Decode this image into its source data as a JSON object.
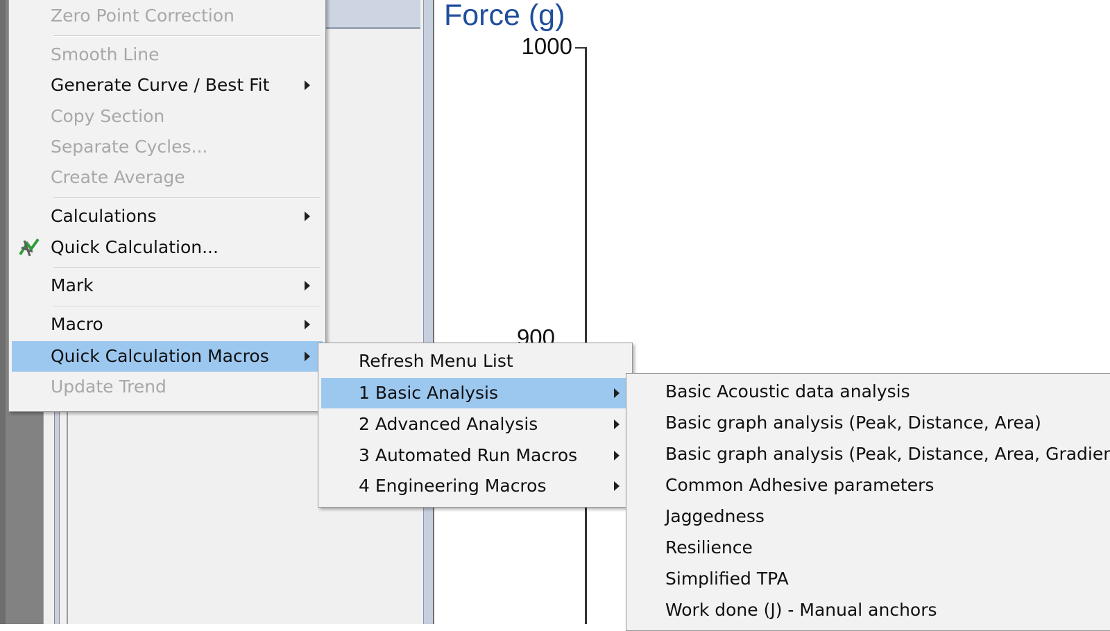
{
  "chart": {
    "title": "Force (g)",
    "y_ticks": [
      "1000",
      "900"
    ]
  },
  "context_menu": {
    "items": [
      {
        "label": "Zero Point Correction",
        "enabled": false,
        "submenu": false
      },
      {
        "label": "Smooth Line",
        "enabled": false,
        "submenu": false
      },
      {
        "label": "Generate Curve / Best Fit",
        "enabled": true,
        "submenu": true
      },
      {
        "label": "Copy Section",
        "enabled": false,
        "submenu": false
      },
      {
        "label": "Separate Cycles...",
        "enabled": false,
        "submenu": false
      },
      {
        "label": "Create Average",
        "enabled": false,
        "submenu": false
      },
      {
        "label": "Calculations",
        "enabled": true,
        "submenu": true
      },
      {
        "label": "Quick Calculation...",
        "enabled": true,
        "submenu": false,
        "icon": "quick-calculation-icon"
      },
      {
        "label": "Mark",
        "enabled": true,
        "submenu": true
      },
      {
        "label": "Macro",
        "enabled": true,
        "submenu": true
      },
      {
        "label": "Quick Calculation Macros",
        "enabled": true,
        "submenu": true,
        "highlighted": true
      },
      {
        "label": "Update Trend",
        "enabled": false,
        "submenu": false
      }
    ]
  },
  "quick_calc_macros_menu": {
    "items": [
      {
        "label": "Refresh Menu List",
        "submenu": false
      },
      {
        "label": "1 Basic Analysis",
        "submenu": true,
        "highlighted": true
      },
      {
        "label": "2 Advanced Analysis",
        "submenu": true
      },
      {
        "label": "3 Automated Run Macros",
        "submenu": true
      },
      {
        "label": "4 Engineering Macros",
        "submenu": true
      }
    ]
  },
  "basic_analysis_menu": {
    "items": [
      {
        "label": "Basic Acoustic data analysis"
      },
      {
        "label": "Basic graph analysis (Peak, Distance, Area)"
      },
      {
        "label": "Basic graph analysis (Peak, Distance, Area, Gradient)"
      },
      {
        "label": "Common Adhesive parameters"
      },
      {
        "label": "Jaggedness"
      },
      {
        "label": "Resilience"
      },
      {
        "label": "Simplified TPA"
      },
      {
        "label": "Work done (J) - Manual anchors"
      }
    ]
  },
  "colors": {
    "highlight": "#9cc8f0",
    "menu_bg": "#f2f2f2",
    "disabled_text": "#a8a8a8",
    "chart_title": "#1f4e9c"
  }
}
